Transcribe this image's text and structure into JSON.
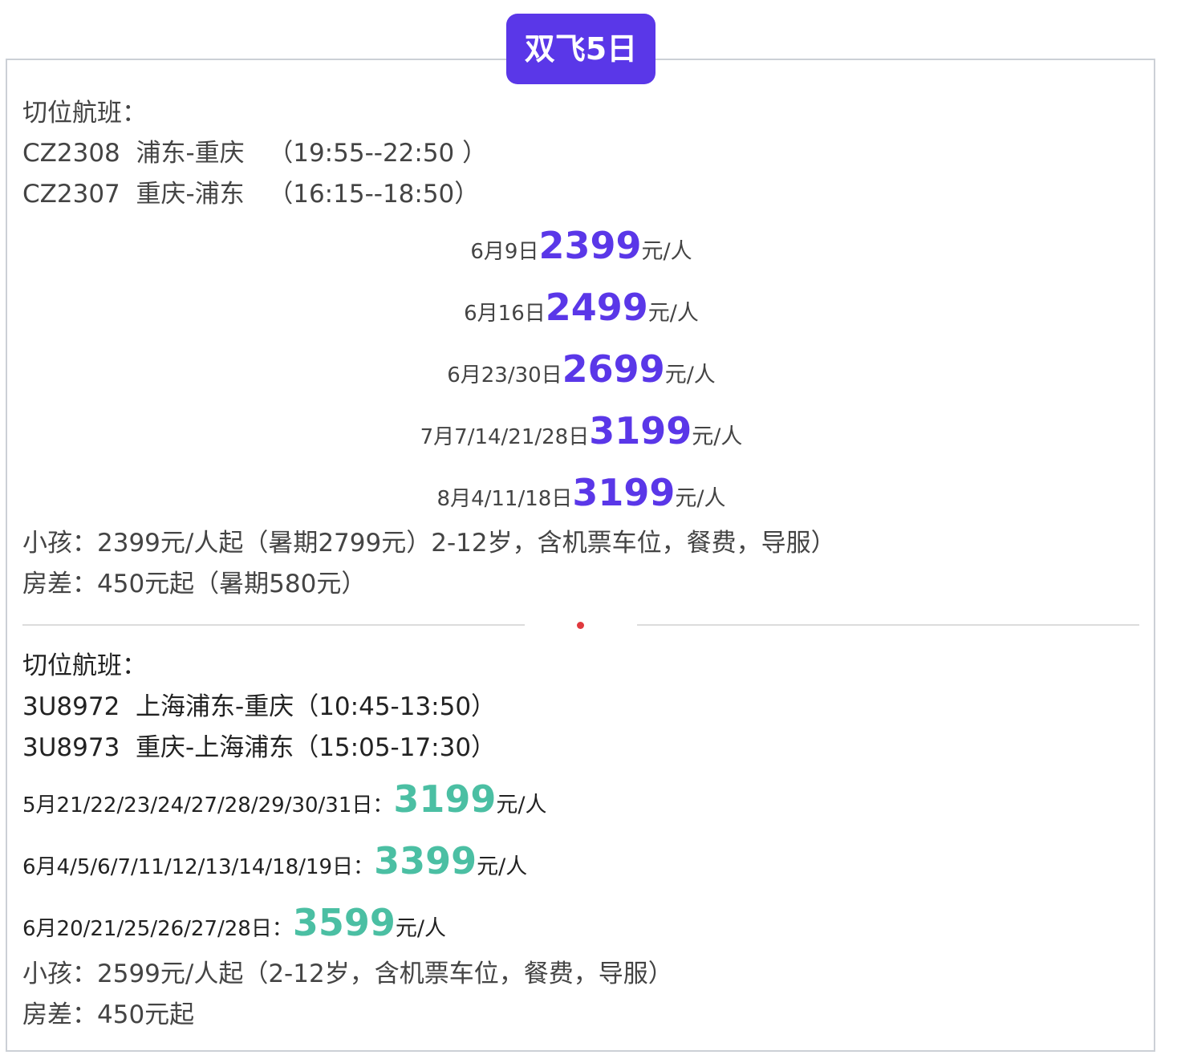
{
  "badge": {
    "title": "双飞5日"
  },
  "section1": {
    "heading": "切位航班：",
    "flights": [
      "CZ2308  浦东-重庆   （19:55--22:50 ）",
      "CZ2307  重庆-浦东   （16:15--18:50）"
    ],
    "prices": [
      {
        "date": "6月9日",
        "price": "2399",
        "unit": "元/人"
      },
      {
        "date": "6月16日",
        "price": "2499",
        "unit": "元/人"
      },
      {
        "date": "6月23/30日",
        "price": "2699",
        "unit": "元/人"
      },
      {
        "date": "7月7/14/21/28日",
        "price": "3199",
        "unit": "元/人"
      },
      {
        "date": "8月4/11/18日",
        "price": "3199",
        "unit": "元/人"
      }
    ],
    "child": "小孩：2399元/人起（暑期2799元）2-12岁，含机票车位，餐费，导服）",
    "room": "房差：450元起（暑期580元）"
  },
  "section2": {
    "heading": "切位航班：",
    "flights": [
      "3U8972  上海浦东-重庆（10:45-13:50）",
      "3U8973  重庆-上海浦东（15:05-17:30）"
    ],
    "prices": [
      {
        "date": "5月21/22/23/24/27/28/29/30/31日：",
        "price": "3199",
        "unit": "元/人"
      },
      {
        "date": "6月4/5/6/7/11/12/13/14/18/19日：",
        "price": "3399",
        "unit": "元/人"
      },
      {
        "date": "6月20/21/25/26/27/28日：",
        "price": "3599",
        "unit": "元/人"
      }
    ],
    "child": "小孩：2599元/人起（2-12岁，含机票车位，餐费，导服）",
    "room": "房差：450元起"
  },
  "colors": {
    "accent_purple": "#5a37e8",
    "accent_teal": "#4bbfa3",
    "divider_dot": "#e0393e"
  }
}
